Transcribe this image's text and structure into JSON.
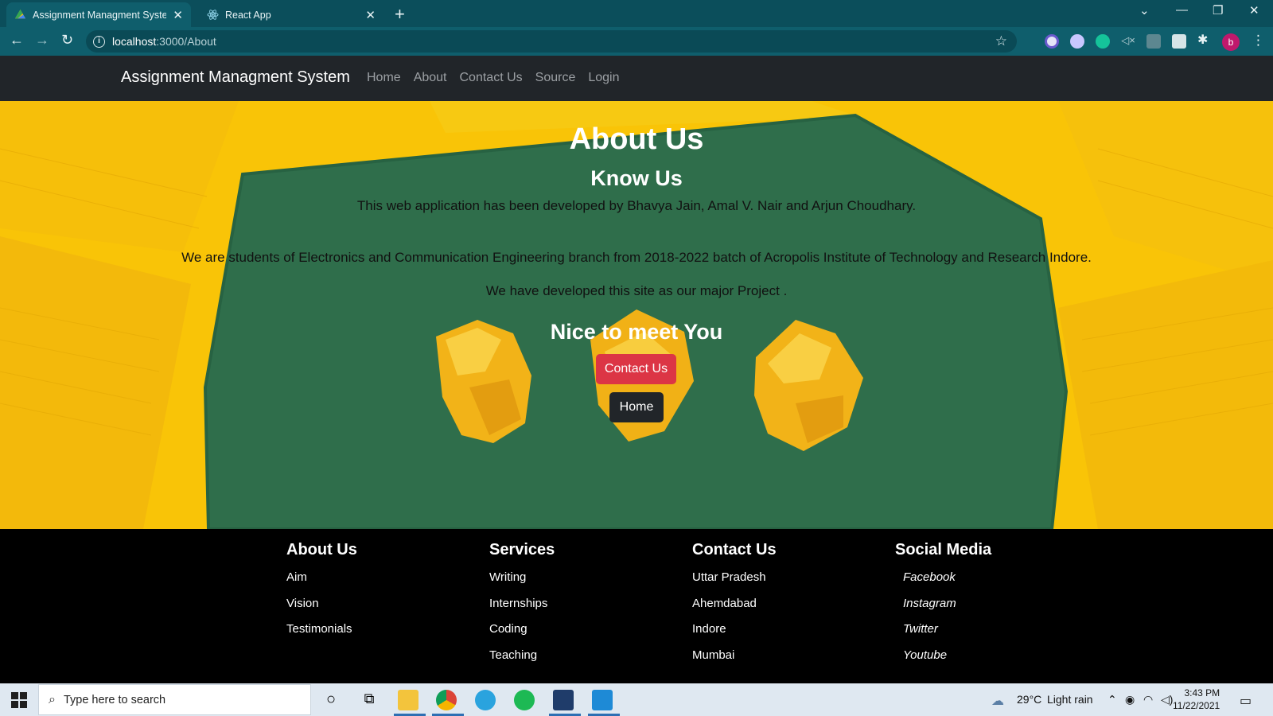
{
  "browser": {
    "tabs": [
      {
        "title": "Assignment Managment System",
        "favicon": "drive-triangle-icon",
        "active": true
      },
      {
        "title": "React App",
        "favicon": "react-icon",
        "active": false
      }
    ],
    "url_host": "localhost",
    "url_path": ":3000/About"
  },
  "navbar": {
    "brand": "Assignment Managment System",
    "links": [
      "Home",
      "About",
      "Contact Us",
      "Source",
      "Login"
    ]
  },
  "hero": {
    "title": "About Us",
    "subtitle": "Know Us",
    "line1": "This web application has been developed by Bhavya Jain, Amal V. Nair and Arjun Choudhary.",
    "line2": "We are students of Electronics and Communication Engineering branch from 2018-2022 batch of Acropolis Institute of Technology and Research Indore.",
    "line3": "We have developed this site as our major Project .",
    "nice": "Nice to meet You",
    "contact_button": "Contact Us",
    "home_button": "Home",
    "colors": {
      "background": "#f9c407",
      "board": "#2f6e4b",
      "contact_btn": "#dc3545",
      "home_btn": "#212529"
    }
  },
  "footer": {
    "columns": [
      {
        "heading": "About Us",
        "items": [
          "Aim",
          "Vision",
          "Testimonials"
        ]
      },
      {
        "heading": "Services",
        "items": [
          "Writing",
          "Internships",
          "Coding",
          "Teaching"
        ]
      },
      {
        "heading": "Contact Us",
        "items": [
          "Uttar Pradesh",
          "Ahemdabad",
          "Indore",
          "Mumbai"
        ]
      },
      {
        "heading": "Social Media",
        "items": [
          "Facebook",
          "Instagram",
          "Twitter",
          "Youtube"
        ]
      }
    ]
  },
  "taskbar": {
    "search_placeholder": "Type here to search",
    "weather_temp": "29°C",
    "weather_text": "Light rain",
    "time": "3:43 PM",
    "date": "11/22/2021"
  }
}
